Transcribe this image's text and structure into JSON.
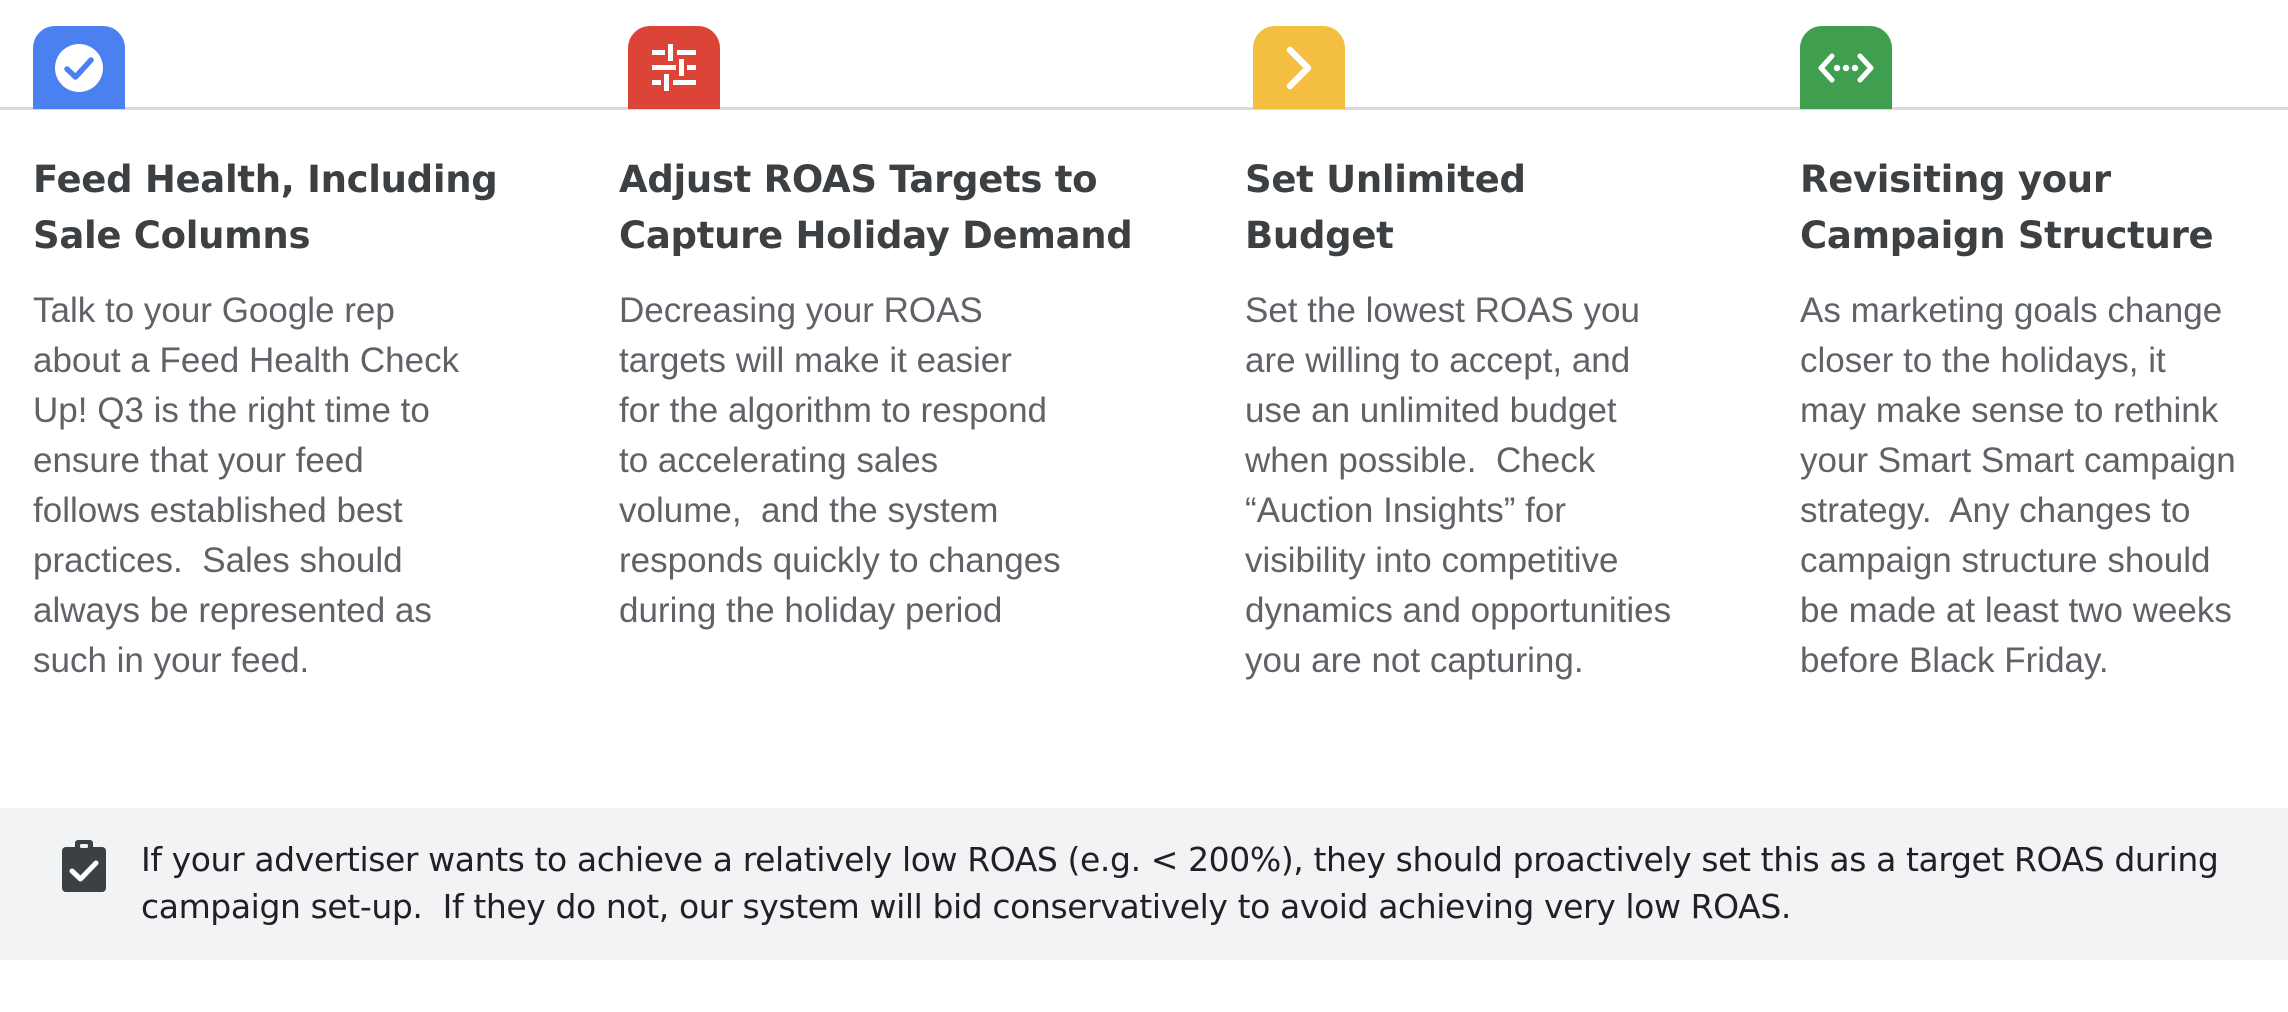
{
  "colors": {
    "blue": "#4a80f0",
    "red": "#dc4437",
    "yellow": "#f4be41",
    "green": "#3f9f4f",
    "title": "#3c4043",
    "body": "#5f6368",
    "note_background": "#f1f3f4"
  },
  "columns": [
    {
      "icon": "check-circle-icon",
      "title_lines": [
        "Feed Health, Including",
        "Sale Columns"
      ],
      "body_lines": [
        "Talk to your Google rep",
        "about a Feed Health Check",
        "Up! Q3 is the right time to",
        "ensure that your feed",
        "follows established best",
        "practices.  Sales should",
        "always be represented as",
        "such in your feed."
      ]
    },
    {
      "icon": "tune-sliders-icon",
      "title_lines": [
        "Adjust ROAS Targets to",
        "Capture Holiday Demand"
      ],
      "body_lines": [
        "Decreasing your ROAS",
        "targets will make it easier",
        "for the algorithm to respond",
        "to accelerating sales",
        "volume,  and the system",
        "responds quickly to changes",
        "during the holiday period"
      ]
    },
    {
      "icon": "chevron-right-icon",
      "title_lines": [
        "Set Unlimited",
        "Budget"
      ],
      "body_lines": [
        "Set the lowest ROAS you",
        "are willing to accept, and",
        "use an unlimited budget",
        "when possible.  Check",
        "“Auction Insights” for",
        "visibility into competitive",
        "dynamics and opportunities",
        "you are not capturing."
      ]
    },
    {
      "icon": "settings-ethernet-icon",
      "title_lines": [
        "Revisiting your",
        "Campaign Structure"
      ],
      "body_lines": [
        "As marketing goals change",
        "closer to the holidays, it",
        "may make sense to rethink",
        "your Smart Smart campaign",
        "strategy.  Any changes to",
        "campaign structure should",
        "be made at least two weeks",
        "before Black Friday."
      ]
    }
  ],
  "note": {
    "icon": "clipboard-check-icon",
    "lines": [
      "If your advertiser wants to achieve a relatively low ROAS (e.g. < 200%), they should proactively set this as a target ROAS during",
      "campaign set-up.  If they do not, our system will bid conservatively to avoid achieving very low ROAS."
    ]
  }
}
